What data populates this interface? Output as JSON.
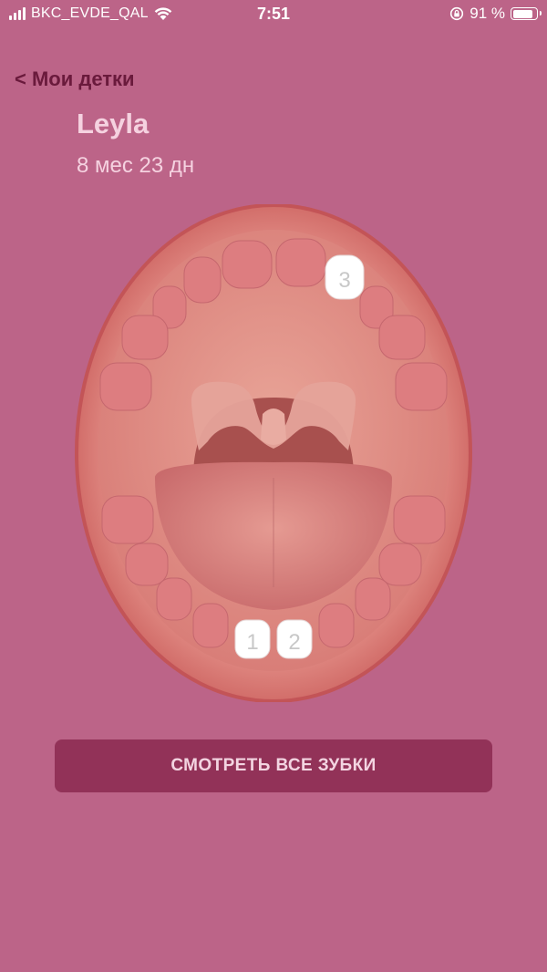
{
  "status_bar": {
    "carrier": "BKC_EVDE_QAL",
    "time": "7:51",
    "battery_text": "91 %",
    "battery_level": 0.91
  },
  "nav": {
    "back_label": "< Мои детки"
  },
  "child": {
    "name": "Leyla",
    "age": "8 мес 23 дн"
  },
  "teeth": {
    "erupted": [
      {
        "number": "1",
        "jaw": "lower"
      },
      {
        "number": "2",
        "jaw": "lower"
      },
      {
        "number": "3",
        "jaw": "upper"
      }
    ]
  },
  "cta": {
    "label": "СМОТРЕТЬ ВСЕ ЗУБКИ"
  },
  "colors": {
    "background": "#bc6488",
    "button": "#923258",
    "tooth_empty": "#dd7d80",
    "tooth_erupted": "#ffffff"
  }
}
